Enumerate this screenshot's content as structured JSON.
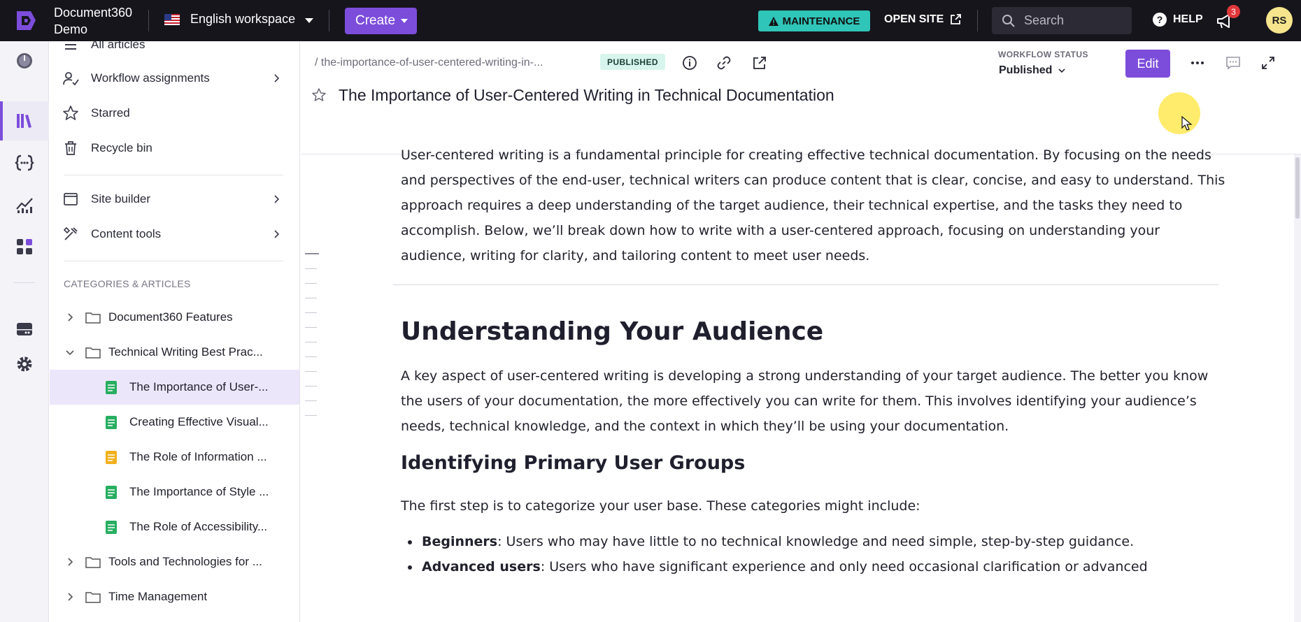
{
  "topbar": {
    "brand_line1": "Document360",
    "brand_line2": "Demo",
    "workspace": "English workspace",
    "create_label": "Create",
    "maintenance_label": "MAINTENANCE",
    "open_site_label": "OPEN SITE",
    "search_placeholder": "Search",
    "help_label": "HELP",
    "notification_count": "3",
    "avatar_initials": "RS",
    "accent_color": "#7c4ddb",
    "maintenance_color": "#2fc5b8"
  },
  "nav": {
    "items": [
      {
        "label": "All articles",
        "icon": "list-icon"
      },
      {
        "label": "Workflow assignments",
        "icon": "workflow-icon"
      },
      {
        "label": "Starred",
        "icon": "star-icon"
      },
      {
        "label": "Recycle bin",
        "icon": "trash-icon"
      },
      {
        "label": "Site builder",
        "icon": "window-icon"
      },
      {
        "label": "Content tools",
        "icon": "tools-icon"
      }
    ],
    "categories_header": "CATEGORIES & ARTICLES",
    "tree": [
      {
        "label": "Document360 Features",
        "type": "category",
        "expanded": false
      },
      {
        "label": "Technical Writing Best Prac...",
        "type": "category",
        "expanded": true
      },
      {
        "label": "The Importance of User-...",
        "type": "article",
        "status_color": "#27ae60",
        "selected": true
      },
      {
        "label": "Creating Effective Visual...",
        "type": "article",
        "status_color": "#27ae60"
      },
      {
        "label": "The Role of Information ...",
        "type": "article",
        "status_color": "#f2b01e"
      },
      {
        "label": "The Importance of Style ...",
        "type": "article",
        "status_color": "#27ae60"
      },
      {
        "label": "The Role of Accessibility...",
        "type": "article",
        "status_color": "#27ae60"
      },
      {
        "label": "Tools and Technologies for ...",
        "type": "category",
        "expanded": false
      },
      {
        "label": "Time Management",
        "type": "category",
        "expanded": false
      }
    ]
  },
  "article": {
    "breadcrumb": "/ the-importance-of-user-centered-writing-in-...",
    "status": "PUBLISHED",
    "workflow_label": "WORKFLOW STATUS",
    "workflow_value": "Published",
    "edit_label": "Edit",
    "title": "The Importance of User-Centered Writing in Technical Documentation",
    "intro": "User-centered writing is a fundamental principle for creating effective technical documentation. By focusing on the needs and perspectives of the end-user, technical writers can produce content that is clear, concise, and easy to understand. This approach requires a deep understanding of the target audience, their technical expertise, and the tasks they need to accomplish. Below, we’ll break down how to write with a user-centered approach, focusing on understanding your audience, writing for clarity, and tailoring content to meet user needs.",
    "h1": "Understanding Your Audience",
    "p2": "A key aspect of user-centered writing is developing a strong understanding of your target audience. The better you know the users of your documentation, the more effectively you can write for them. This involves identifying your audience’s needs, technical knowledge, and the context in which they’ll be using your documentation.",
    "h2": "Identifying Primary User Groups",
    "p3": "The first step is to categorize your user base. These categories might include:",
    "bullets": [
      {
        "term": "Beginners",
        "text": ": Users who may have little to no technical knowledge and need simple, step-by-step guidance."
      },
      {
        "term": "Advanced users",
        "text": ": Users who have significant experience and only need occasional clarification or advanced"
      }
    ]
  }
}
